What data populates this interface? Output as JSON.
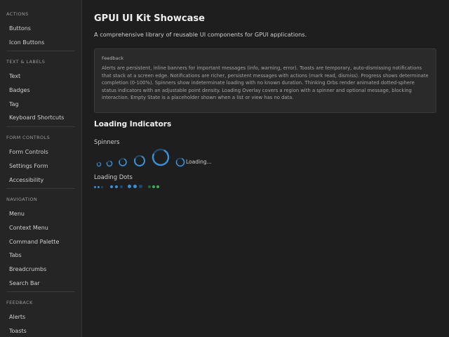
{
  "sidebar": {
    "sections": [
      {
        "header": "ACTIONS",
        "items": [
          "Buttons",
          "Icon Buttons"
        ]
      },
      {
        "header": "TEXT & LABELS",
        "items": [
          "Text",
          "Badges",
          "Tag",
          "Keyboard Shortcuts"
        ]
      },
      {
        "header": "FORM CONTROLS",
        "items": [
          "Form Controls",
          "Settings Form",
          "Accessibility"
        ]
      },
      {
        "header": "NAVIGATION",
        "items": [
          "Menu",
          "Context Menu",
          "Command Palette",
          "Tabs",
          "Breadcrumbs",
          "Search Bar"
        ]
      },
      {
        "header": "FEEDBACK",
        "items": [
          "Alerts",
          "Toasts"
        ]
      }
    ]
  },
  "main": {
    "title": "GPUI UI Kit Showcase",
    "subtitle": "A comprehensive library of reusable UI components for GPUI applications.",
    "feedback_card": {
      "label": "Feedback",
      "text": "Alerts are persistent, inline banners for important messages (info, warning, error). Toasts are temporary, auto-dismissing notifications that stack at a screen edge. Notifications are richer, persistent messages with actions (mark read, dismiss). Progress shows determinate completion (0-100%). Spinners show indeterminate loading with no known duration. Thinking Orbs render animated dotted-sphere status indicators with an adjustable point density. Loading Overlay covers a region with a spinner and optional message, blocking interaction. Empty State is a placeholder shown when a list or view has no data."
    },
    "loading_heading": "Loading Indicators",
    "spinners_heading": "Spinners",
    "spinner_label": "Loading...",
    "dots_heading": "Loading Dots"
  },
  "colors": {
    "accent": "#3a8fd6",
    "accent_dim": "#1f4a6e",
    "green": "#3fae5a",
    "green_dim": "#256b38"
  }
}
